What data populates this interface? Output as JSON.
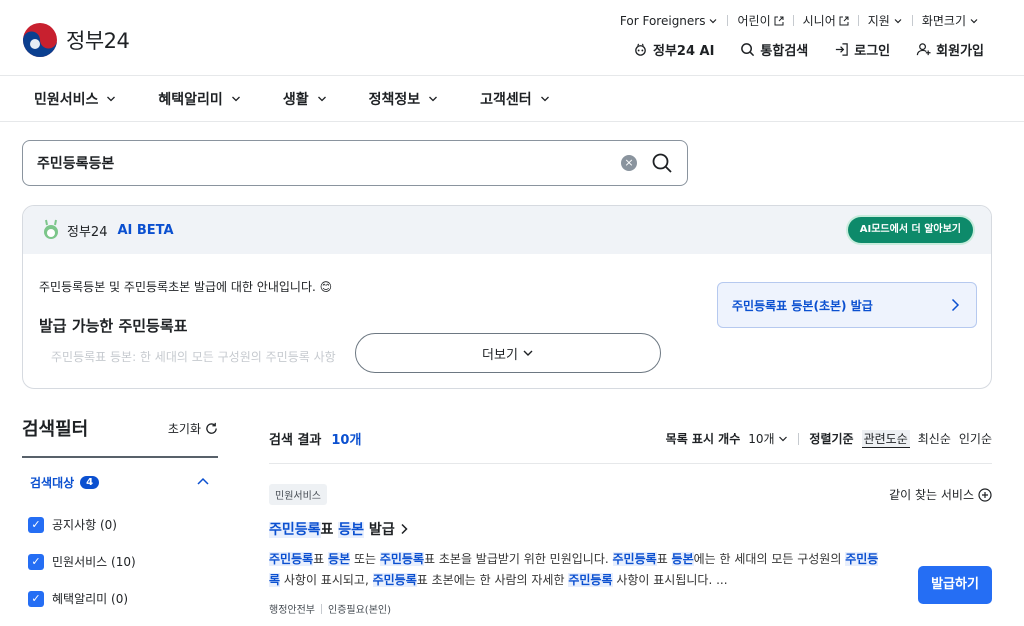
{
  "header": {
    "logo_text": "정부24",
    "util_links": [
      "For Foreigners",
      "어린이",
      "시니어",
      "지원",
      "화면크기"
    ],
    "main_links": [
      "정부24 AI",
      "통합검색",
      "로그인",
      "회원가입"
    ]
  },
  "nav": [
    "민원서비스",
    "혜택알리미",
    "생활",
    "정책정보",
    "고객센터"
  ],
  "search": {
    "value": "주민등록등본",
    "clear": "×"
  },
  "ai_panel": {
    "brand": "정부24",
    "beta": "AI BETA",
    "mode_button": "AI모드에서 더 알아보기",
    "intro": "주민등록등본 및 주민등록초본 발급에 대한 안내입니다. 😊",
    "subtitle": "발급 가능한 주민등록표",
    "bullet": "주민등록표 등본: 한 세대의 모든 구성원의 주민등록 사항",
    "link": "주민등록표 등본(초본) 발급",
    "more": "더보기"
  },
  "filter": {
    "title": "검색필터",
    "reset": "초기화",
    "group_title": "검색대상",
    "group_count": "4",
    "items": [
      "공지사항 (0)",
      "민원서비스 (10)",
      "혜택알리미 (0)"
    ]
  },
  "results": {
    "title": "검색 결과",
    "count": "10개",
    "per_page_label": "목록 표시 개수",
    "per_page_value": "10개",
    "sort_label": "정렬기준",
    "sort_options": [
      "관련도순",
      "최신순",
      "인기순"
    ],
    "card": {
      "category": "민원서비스",
      "same_service": "같이 찾는 서비스",
      "title_hl1": "주민등록",
      "title_t1": "표 ",
      "title_hl2": "등본",
      "title_t2": " 발급",
      "desc": {
        "h1": "주민등록",
        "t1": "표 ",
        "h2": "등본",
        "t2": " 또는 ",
        "h3": "주민등록",
        "t3": "표 초본을 발급받기 위한 민원입니다. ",
        "h4": "주민등록",
        "t4": "표 ",
        "h5": "등본",
        "t5": "에는 한 세대의 모든 구성원의 ",
        "h6": "주민등록",
        "t6": " 사항이 표시되고, ",
        "h7": "주민등록",
        "t7": "표 초본에는 한 사람의 자세한 ",
        "h8": "주민등록",
        "t8": " 사항이 표시됩니다. ..."
      },
      "meta1": "행정안전부",
      "meta2": "인증필요(본인)",
      "apply": "발급하기"
    }
  }
}
